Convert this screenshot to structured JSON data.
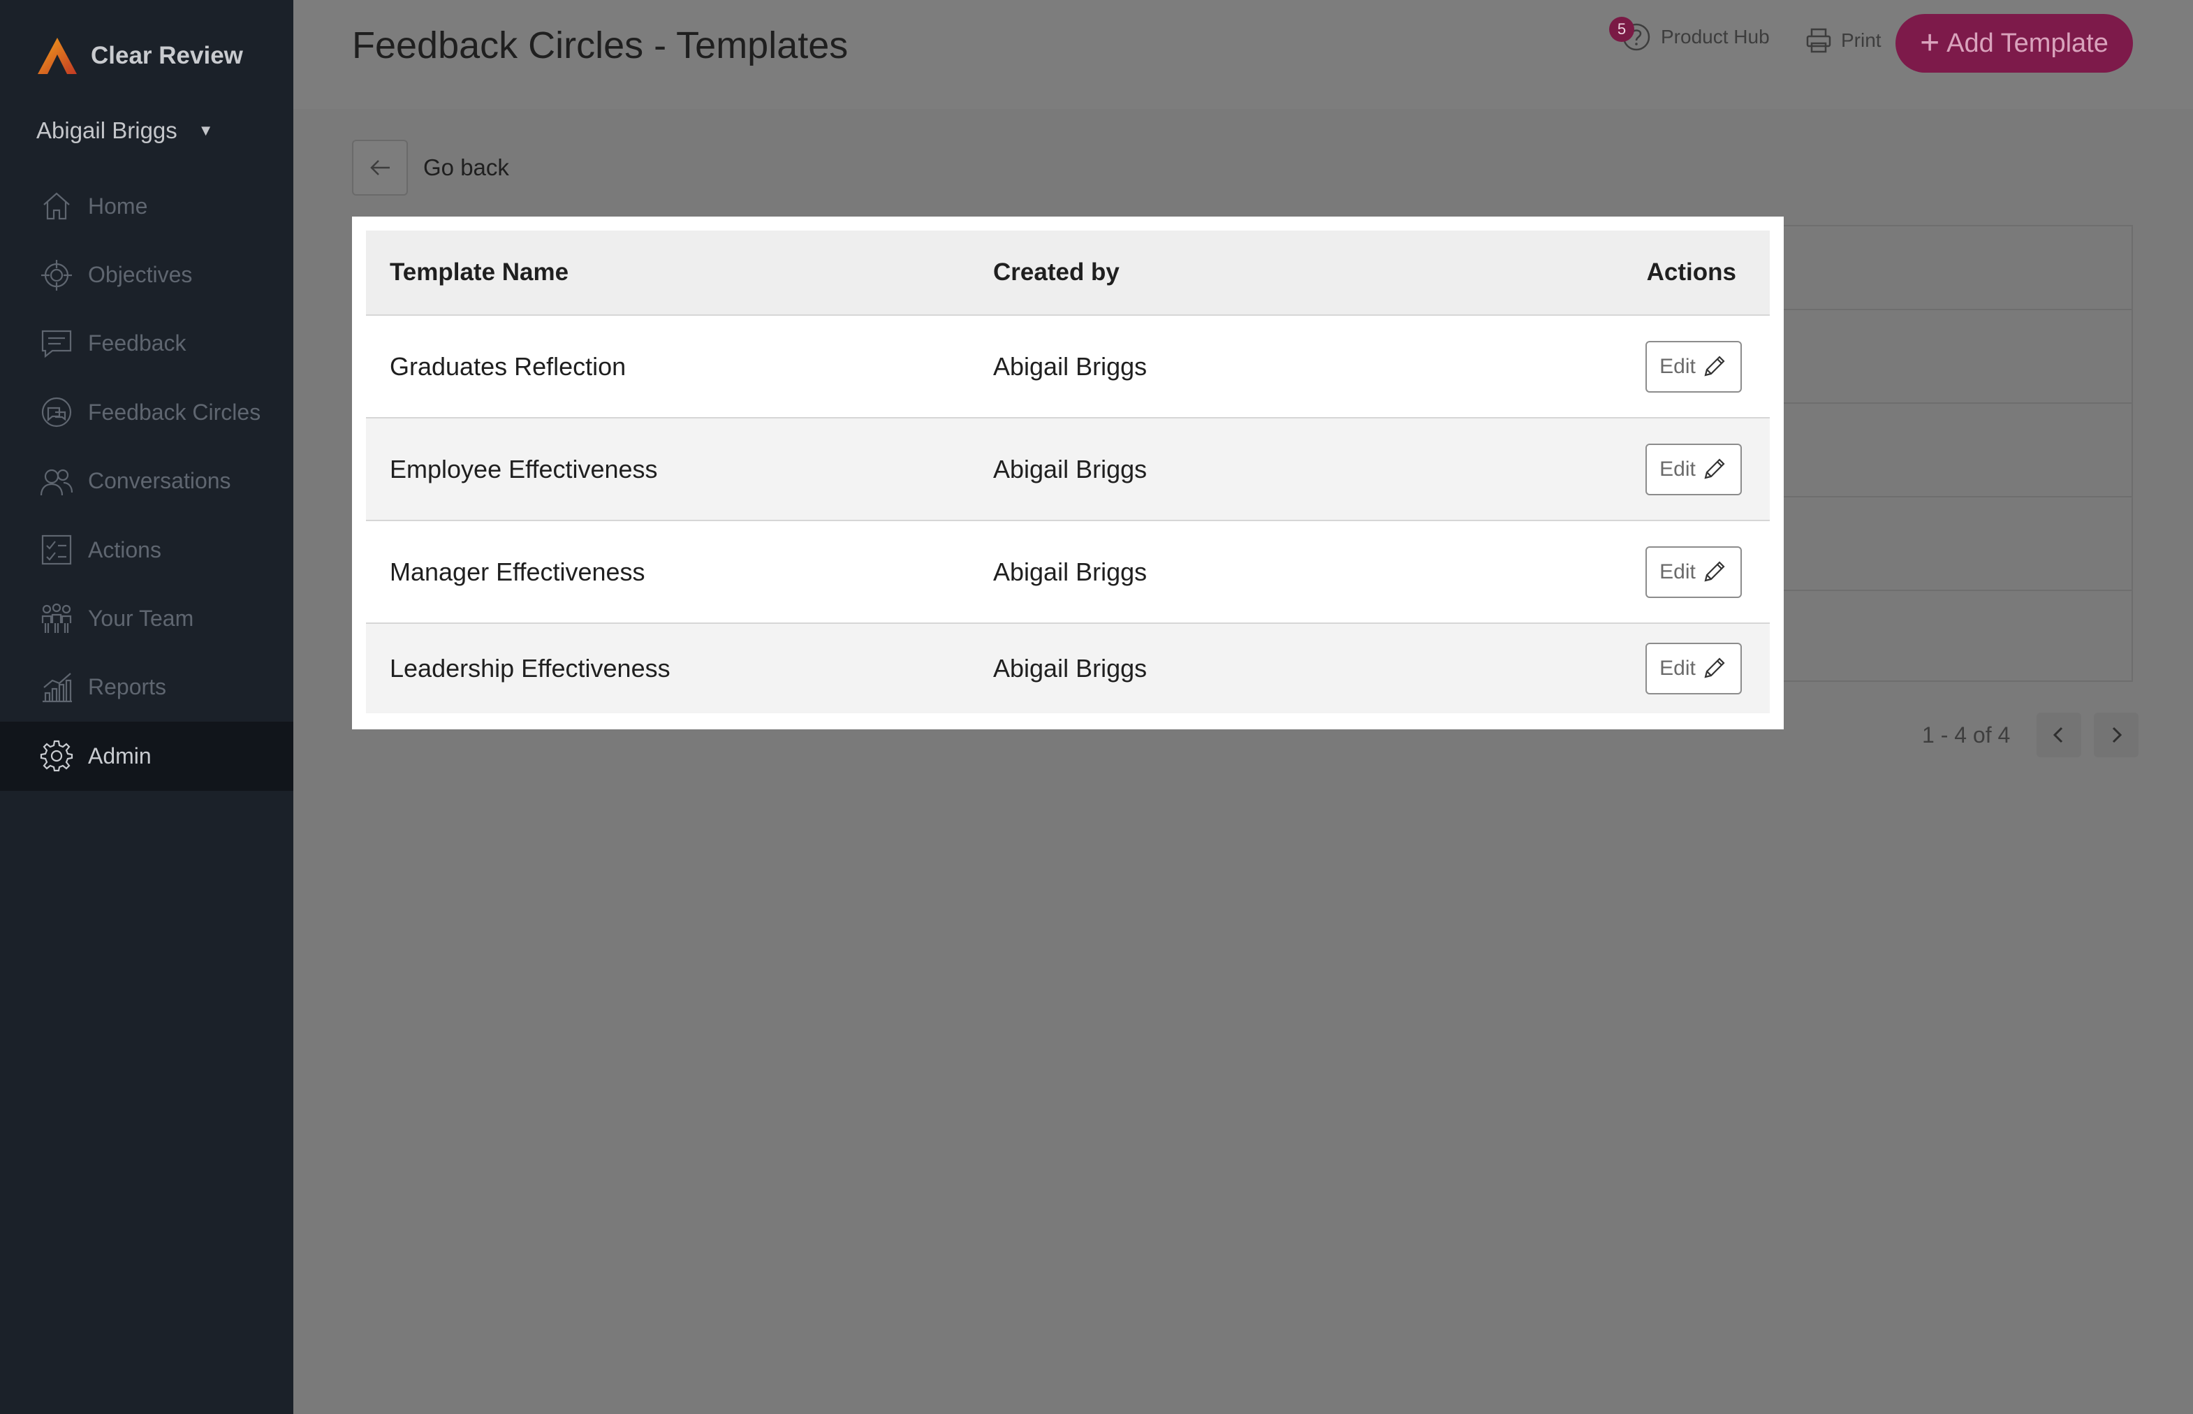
{
  "brand": {
    "name": "Clear Review"
  },
  "user": {
    "name": "Abigail Briggs"
  },
  "nav": {
    "items": [
      {
        "label": "Home",
        "icon": "home-icon"
      },
      {
        "label": "Objectives",
        "icon": "target-icon"
      },
      {
        "label": "Feedback",
        "icon": "feedback-icon"
      },
      {
        "label": "Feedback Circles",
        "icon": "circles-icon"
      },
      {
        "label": "Conversations",
        "icon": "conversations-icon"
      },
      {
        "label": "Actions",
        "icon": "checklist-icon"
      },
      {
        "label": "Your Team",
        "icon": "team-icon"
      },
      {
        "label": "Reports",
        "icon": "chart-icon"
      },
      {
        "label": "Admin",
        "icon": "gear-icon",
        "active": true
      }
    ]
  },
  "header": {
    "title": "Feedback Circles - Templates",
    "product_hub_label": "Product Hub",
    "product_hub_badge": "5",
    "print_label": "Print",
    "add_button_label": "Add Template"
  },
  "go_back": {
    "label": "Go back"
  },
  "table": {
    "columns": [
      "Template Name",
      "Created by",
      "Actions"
    ],
    "rows": [
      {
        "name": "Graduates Reflection",
        "created_by": "Abigail Briggs",
        "action": "Edit"
      },
      {
        "name": "Employee Effectiveness",
        "created_by": "Abigail Briggs",
        "action": "Edit"
      },
      {
        "name": "Manager Effectiveness",
        "created_by": "Abigail Briggs",
        "action": "Edit"
      },
      {
        "name": "Leadership Effectiveness",
        "created_by": "Abigail Briggs",
        "action": "Edit"
      }
    ]
  },
  "pagination": {
    "range": "1 - 4 of 4"
  },
  "colors": {
    "accent": "#7d1a4a",
    "sidebar_bg": "#1b2129",
    "overlay_bg": "#7a7a7a"
  }
}
